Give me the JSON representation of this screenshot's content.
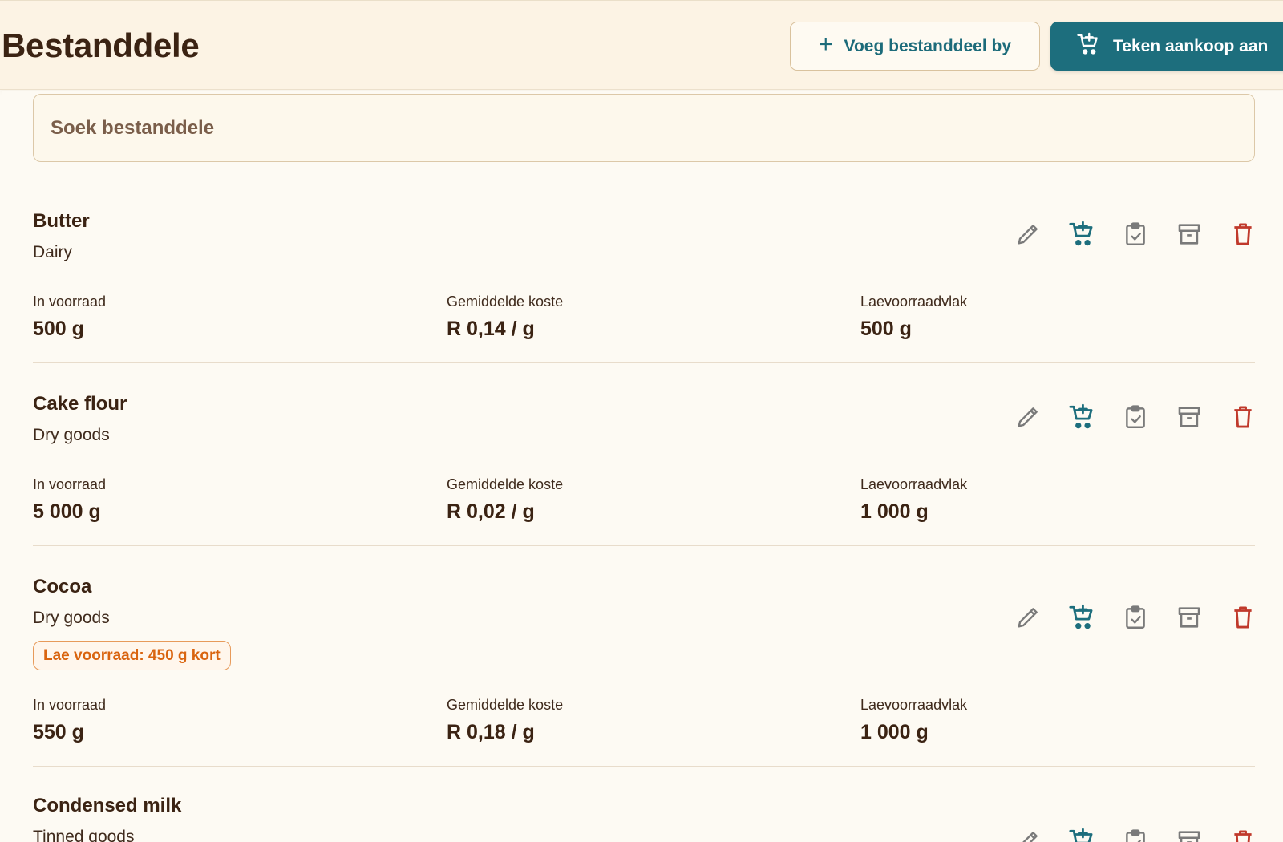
{
  "header": {
    "title": "Bestanddele",
    "add_button": "Voeg bestanddeel by",
    "purchase_button": "Teken aankoop aan"
  },
  "search": {
    "placeholder": "Soek bestanddele"
  },
  "labels": {
    "in_stock": "In voorraad",
    "avg_cost": "Gemiddelde koste",
    "low_threshold": "Laevoorraadvlak"
  },
  "items": [
    {
      "name": "Butter",
      "category": "Dairy",
      "in_stock": "500 g",
      "avg_cost": "R 0,14 / g",
      "low_threshold": "500 g"
    },
    {
      "name": "Cake flour",
      "category": "Dry goods",
      "in_stock": "5 000 g",
      "avg_cost": "R 0,02 / g",
      "low_threshold": "1 000 g"
    },
    {
      "name": "Cocoa",
      "category": "Dry goods",
      "badge": "Lae voorraad: 450 g kort",
      "in_stock": "550 g",
      "avg_cost": "R 0,18 / g",
      "low_threshold": "1 000 g"
    },
    {
      "name": "Condensed milk",
      "category": "Tinned goods"
    }
  ],
  "icons": {
    "add": "plus-icon",
    "purchase": "cart-plus-icon",
    "edit": "pencil-icon",
    "restock": "cart-plus-icon",
    "stocktake": "clipboard-check-icon",
    "archive": "archive-icon",
    "delete": "trash-icon"
  },
  "colors": {
    "accent": "#1d6e7d",
    "danger": "#c0392b",
    "warning": "#d9640f",
    "neutral_icon": "#7a7a7a",
    "background": "#fdfaf3"
  }
}
